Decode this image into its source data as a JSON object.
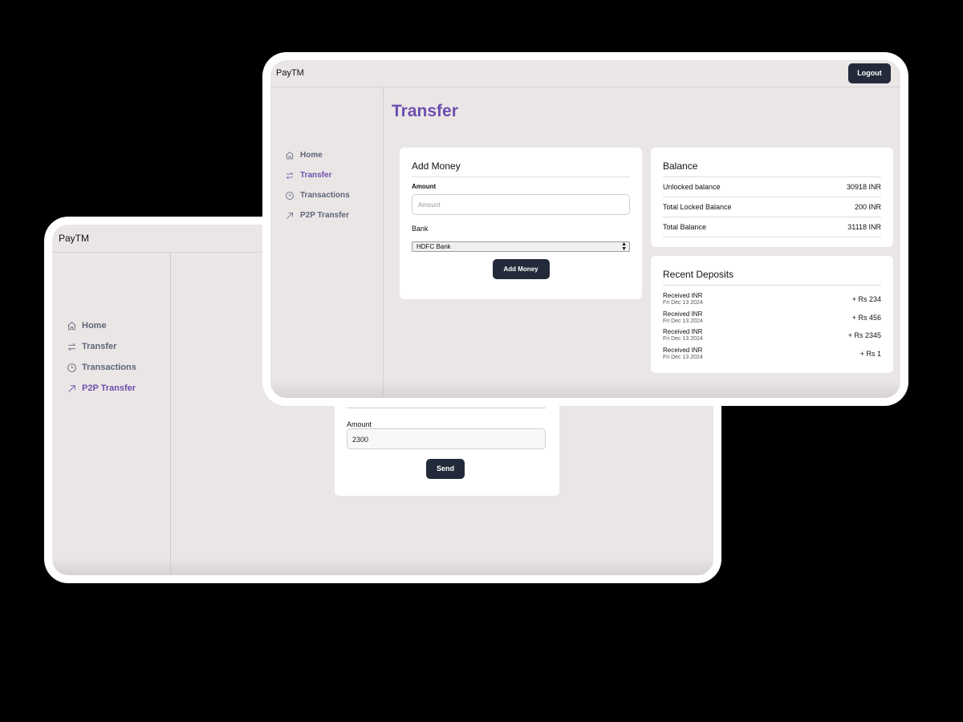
{
  "back_window": {
    "brand": "PayTM",
    "nav": [
      {
        "label": "Home",
        "icon": "home-icon",
        "active": false
      },
      {
        "label": "Transfer",
        "icon": "transfer-icon",
        "active": false
      },
      {
        "label": "Transactions",
        "icon": "clock-icon",
        "active": false
      },
      {
        "label": "P2P Transfer",
        "icon": "arrow-up-right-icon",
        "active": true
      }
    ],
    "send_card": {
      "amount_label": "Amount",
      "amount_value": "2300",
      "send_label": "Send"
    }
  },
  "front_window": {
    "brand": "PayTM",
    "logout_label": "Logout",
    "nav": [
      {
        "label": "Home",
        "icon": "home-icon",
        "active": false
      },
      {
        "label": "Transfer",
        "icon": "transfer-icon",
        "active": true
      },
      {
        "label": "Transactions",
        "icon": "clock-icon",
        "active": false
      },
      {
        "label": "P2P Transfer",
        "icon": "arrow-up-right-icon",
        "active": false
      }
    ],
    "page_title": "Transfer",
    "add_money": {
      "title": "Add Money",
      "amount_label": "Amount",
      "amount_placeholder": "Amount",
      "bank_label": "Bank",
      "bank_selected": "HDFC Bank",
      "button_label": "Add Money"
    },
    "balance": {
      "title": "Balance",
      "rows": [
        {
          "label": "Unlocked balance",
          "value": "30918 INR"
        },
        {
          "label": "Total Locked Balance",
          "value": "200 INR"
        },
        {
          "label": "Total Balance",
          "value": "31118 INR"
        }
      ]
    },
    "deposits": {
      "title": "Recent Deposits",
      "items": [
        {
          "title": "Received INR",
          "date": "Fri Dec 13 2024",
          "amount": "+ Rs 234"
        },
        {
          "title": "Received INR",
          "date": "Fri Dec 13 2024",
          "amount": "+ Rs 456"
        },
        {
          "title": "Received INR",
          "date": "Fri Dec 13 2024",
          "amount": "+ Rs 2345"
        },
        {
          "title": "Received INR",
          "date": "Fri Dec 13 2024",
          "amount": "+ Rs 1"
        }
      ]
    }
  },
  "colors": {
    "accent": "#6c4fae",
    "nav_text": "#5d6678",
    "button_bg": "#232b3a",
    "screen_bg": "#ebe6e6"
  }
}
